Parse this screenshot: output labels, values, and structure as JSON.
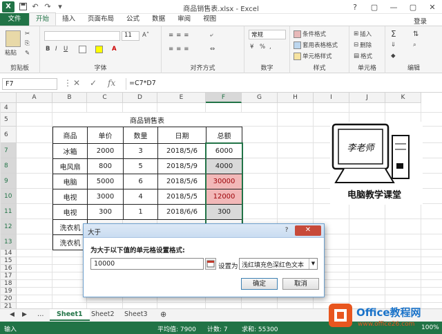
{
  "window": {
    "title": "商品销售表.xlsx - Excel",
    "controls": [
      "?",
      "▢",
      "—",
      "▢",
      "✕"
    ],
    "app_icon_letter": "X",
    "qa": [
      "save-icon",
      "undo-icon",
      "redo-icon",
      "customize-icon"
    ]
  },
  "tabs": [
    "文件",
    "开始",
    "插入",
    "页面布局",
    "公式",
    "数据",
    "审阅",
    "视图"
  ],
  "active_tab": "开始",
  "login": "登录",
  "ribbon": {
    "groups": [
      "剪贴板",
      "字体",
      "对齐方式",
      "数字",
      "样式",
      "单元格",
      "编辑"
    ],
    "paste": "粘贴",
    "font_size": "11",
    "number_format": "常规",
    "conditional": "条件格式",
    "table_format": "套用表格格式",
    "cell_style": "单元格样式",
    "insert": "插入",
    "delete": "删除",
    "format": "格式",
    "percent": "%"
  },
  "formula_bar": {
    "name_box": "F7",
    "formula": "=C7*D7",
    "fx": "fx"
  },
  "columns": [
    "A",
    "B",
    "C",
    "D",
    "E",
    "F",
    "G",
    "H",
    "I",
    "J",
    "K"
  ],
  "rows": [
    "4",
    "5",
    "6",
    "7",
    "8",
    "9",
    "10",
    "11",
    "12",
    "13",
    "14",
    "15",
    "16",
    "17",
    "18",
    "19",
    "20",
    "21"
  ],
  "sheet": {
    "table_title": "商品销售表",
    "headers": [
      "商品",
      "单价",
      "数量",
      "日期",
      "总额"
    ],
    "data": [
      [
        "冰箱",
        "2000",
        "3",
        "2018/5/6",
        "6000"
      ],
      [
        "电风扇",
        "800",
        "5",
        "2018/5/9",
        "4000"
      ],
      [
        "电脑",
        "5000",
        "6",
        "2018/5/6",
        "30000"
      ],
      [
        "电视",
        "3000",
        "4",
        "2018/5/5",
        "12000"
      ],
      [
        "电视",
        "300",
        "1",
        "2018/6/6",
        "300"
      ],
      [
        "洗衣机",
        "",
        "",
        "",
        ""
      ],
      [
        "洗衣机",
        "",
        "",
        "",
        ""
      ]
    ],
    "highlight_color": "#f2b8b8",
    "highlight_text": "#9c0006",
    "gray_fill": "#d9d9d9"
  },
  "logo": {
    "screen_text": "李老师",
    "caption": "电脑教学课堂"
  },
  "dialog": {
    "title": "大于",
    "help": "?",
    "close": "✕",
    "prompt": "为大于以下值的单元格设置格式:",
    "value": "10000",
    "set_label": "设置为",
    "format_option": "浅红填充色深红色文本",
    "ok": "确定",
    "cancel": "取消"
  },
  "sheets": [
    "Sheet1",
    "Sheet2",
    "Sheet3"
  ],
  "active_sheet": "Sheet1",
  "status": {
    "mode": "输入",
    "average": "平均值: 7900",
    "count": "计数: 7",
    "sum": "求和: 55300",
    "zoom": "100%"
  },
  "watermark": {
    "brand": "Office教程网",
    "url": "www.office26.com"
  }
}
